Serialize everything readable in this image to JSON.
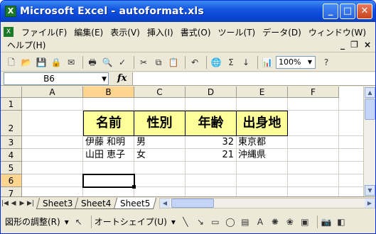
{
  "window": {
    "title": "Microsoft Excel - autoformat.xls",
    "app_icon_glyph": "X",
    "minimize": "_",
    "maximize": "□",
    "close": "✕"
  },
  "menu": {
    "items": [
      "ファイル(F)",
      "編集(E)",
      "表示(V)",
      "挿入(I)",
      "書式(O)",
      "ツール(T)",
      "データ(D)",
      "ウィンドウ(W)"
    ],
    "help": "ヘルプ(H)",
    "doc_minimize": "_",
    "doc_restore": "❐",
    "doc_close": "×"
  },
  "toolbar": {
    "zoom": "100%",
    "icons": [
      "new-icon",
      "open-icon",
      "save-icon",
      "permission-icon",
      "mail-icon",
      "print-icon",
      "print-preview-icon",
      "spelling-icon",
      "cut-icon",
      "copy-icon",
      "paste-icon",
      "undo-icon",
      "hyperlink-icon",
      "autosum-icon",
      "sort-ascending-icon",
      "chart-wizard-icon",
      "help-icon"
    ]
  },
  "formula_bar": {
    "name_box": "B6",
    "fx_label": "fx",
    "value": ""
  },
  "sheet": {
    "columns": [
      "A",
      "B",
      "C",
      "D",
      "E",
      "F"
    ],
    "selected_column": "B",
    "rows": [
      "1",
      "2",
      "3",
      "4",
      "5",
      "6",
      "7"
    ],
    "selected_row": "6",
    "header_row": [
      "名前",
      "性別",
      "年齢",
      "出身地"
    ],
    "data_rows": [
      [
        "伊藤 和明",
        "男",
        "32",
        "東京都"
      ],
      [
        "山田 恵子",
        "女",
        "21",
        "沖縄県"
      ]
    ],
    "header_fill": "#ffff99"
  },
  "tabs": {
    "sheets": [
      "Sheet3",
      "Sheet4",
      "Sheet5"
    ],
    "active": "Sheet5"
  },
  "drawing_toolbar": {
    "draw_menu": "図形の調整(R)",
    "autoshapes": "オートシェイプ(U)"
  }
}
